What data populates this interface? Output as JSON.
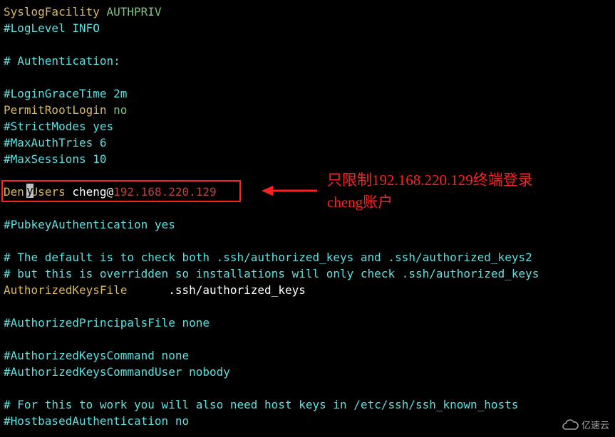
{
  "config": {
    "l1a": "SyslogFacility ",
    "l1b": "AUTHPRIV",
    "l2": "#LogLevel INFO",
    "l3": "# Authentication:",
    "l4": "#LoginGraceTime 2m",
    "l5a": "PermitRootLogin ",
    "l5b": "no",
    "l6": "#StrictModes yes",
    "l7": "#MaxAuthTries 6",
    "l8": "#MaxSessions 10",
    "l9a": "Den",
    "l9cursor": "y",
    "l9b": "Users",
    "l9c": " cheng@",
    "l9d": "192.168.220.129",
    "l10": "#PubkeyAuthentication yes",
    "l11": "# The default is to check both .ssh/authorized_keys and .ssh/authorized_keys2",
    "l12": "# but this is overridden so installations will only check .ssh/authorized_keys",
    "l13a": "AuthorizedKeysFile",
    "l13b": "      .ssh/authorized_keys",
    "l14": "#AuthorizedPrincipalsFile none",
    "l15": "#AuthorizedKeysCommand none",
    "l16": "#AuthorizedKeysCommandUser nobody",
    "l17": "# For this to work you will also need host keys in /etc/ssh/ssh_known_hosts",
    "l18": "#HostbasedAuthentication no"
  },
  "annotation": {
    "line1": "只限制192.168.220.129终端登录",
    "line2": "cheng账户"
  },
  "watermark": {
    "text": "亿速云"
  }
}
